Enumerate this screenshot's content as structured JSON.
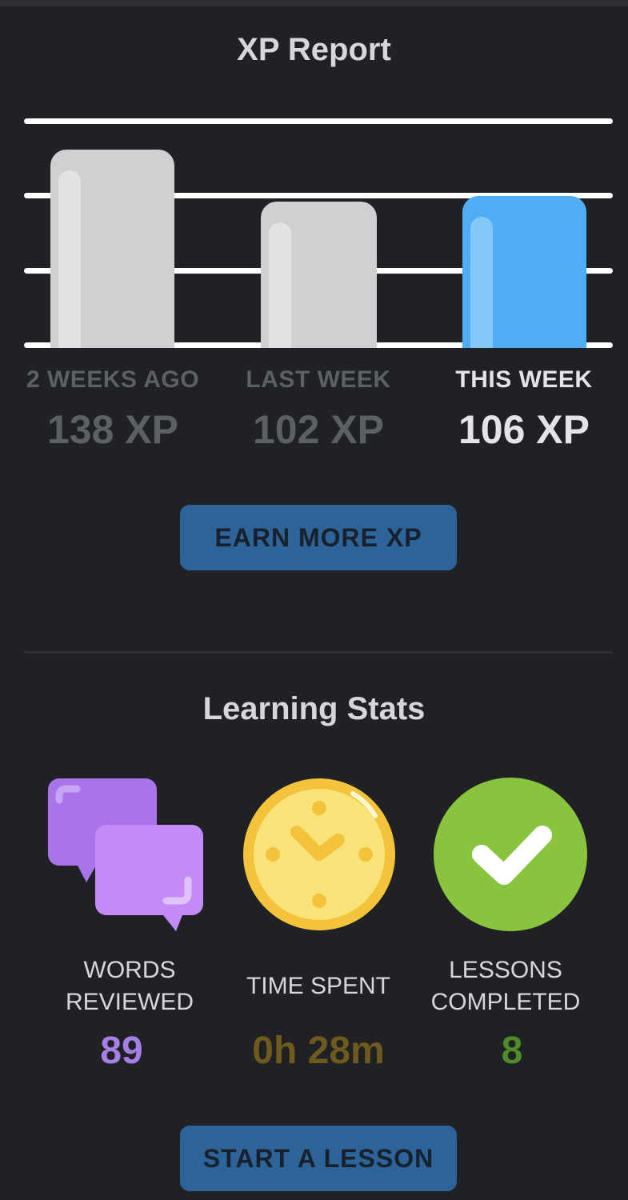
{
  "xp_report": {
    "title": "XP Report",
    "weeks": [
      {
        "label": "2 WEEKS AGO",
        "value_text": "138 XP",
        "xp": 138,
        "highlight": false
      },
      {
        "label": "LAST WEEK",
        "value_text": "102 XP",
        "xp": 102,
        "highlight": false
      },
      {
        "label": "THIS WEEK",
        "value_text": "106 XP",
        "xp": 106,
        "highlight": true
      }
    ],
    "earn_button": "EARN MORE XP"
  },
  "chart_data": {
    "type": "bar",
    "categories": [
      "2 WEEKS AGO",
      "LAST WEEK",
      "THIS WEEK"
    ],
    "values": [
      138,
      102,
      106
    ],
    "title": "XP Report",
    "xlabel": "",
    "ylabel": "",
    "ylim": [
      0,
      160
    ],
    "grid": true,
    "colors": {
      "past": "#cfd0d2",
      "current": "#51adf3"
    }
  },
  "learning_stats": {
    "title": "Learning Stats",
    "items": [
      {
        "icon": "speech-bubbles-icon",
        "label_lines": [
          "WORDS",
          "REVIEWED"
        ],
        "value": "89",
        "color": "#a57ee6"
      },
      {
        "icon": "clock-icon",
        "label_lines": [
          "TIME SPENT"
        ],
        "value": "0h 28m",
        "color": "#6f5a1d"
      },
      {
        "icon": "checkmark-icon",
        "label_lines": [
          "LESSONS",
          "COMPLETED"
        ],
        "value": "8",
        "color": "#4c8a2a"
      }
    ],
    "start_button": "START A LESSON"
  }
}
